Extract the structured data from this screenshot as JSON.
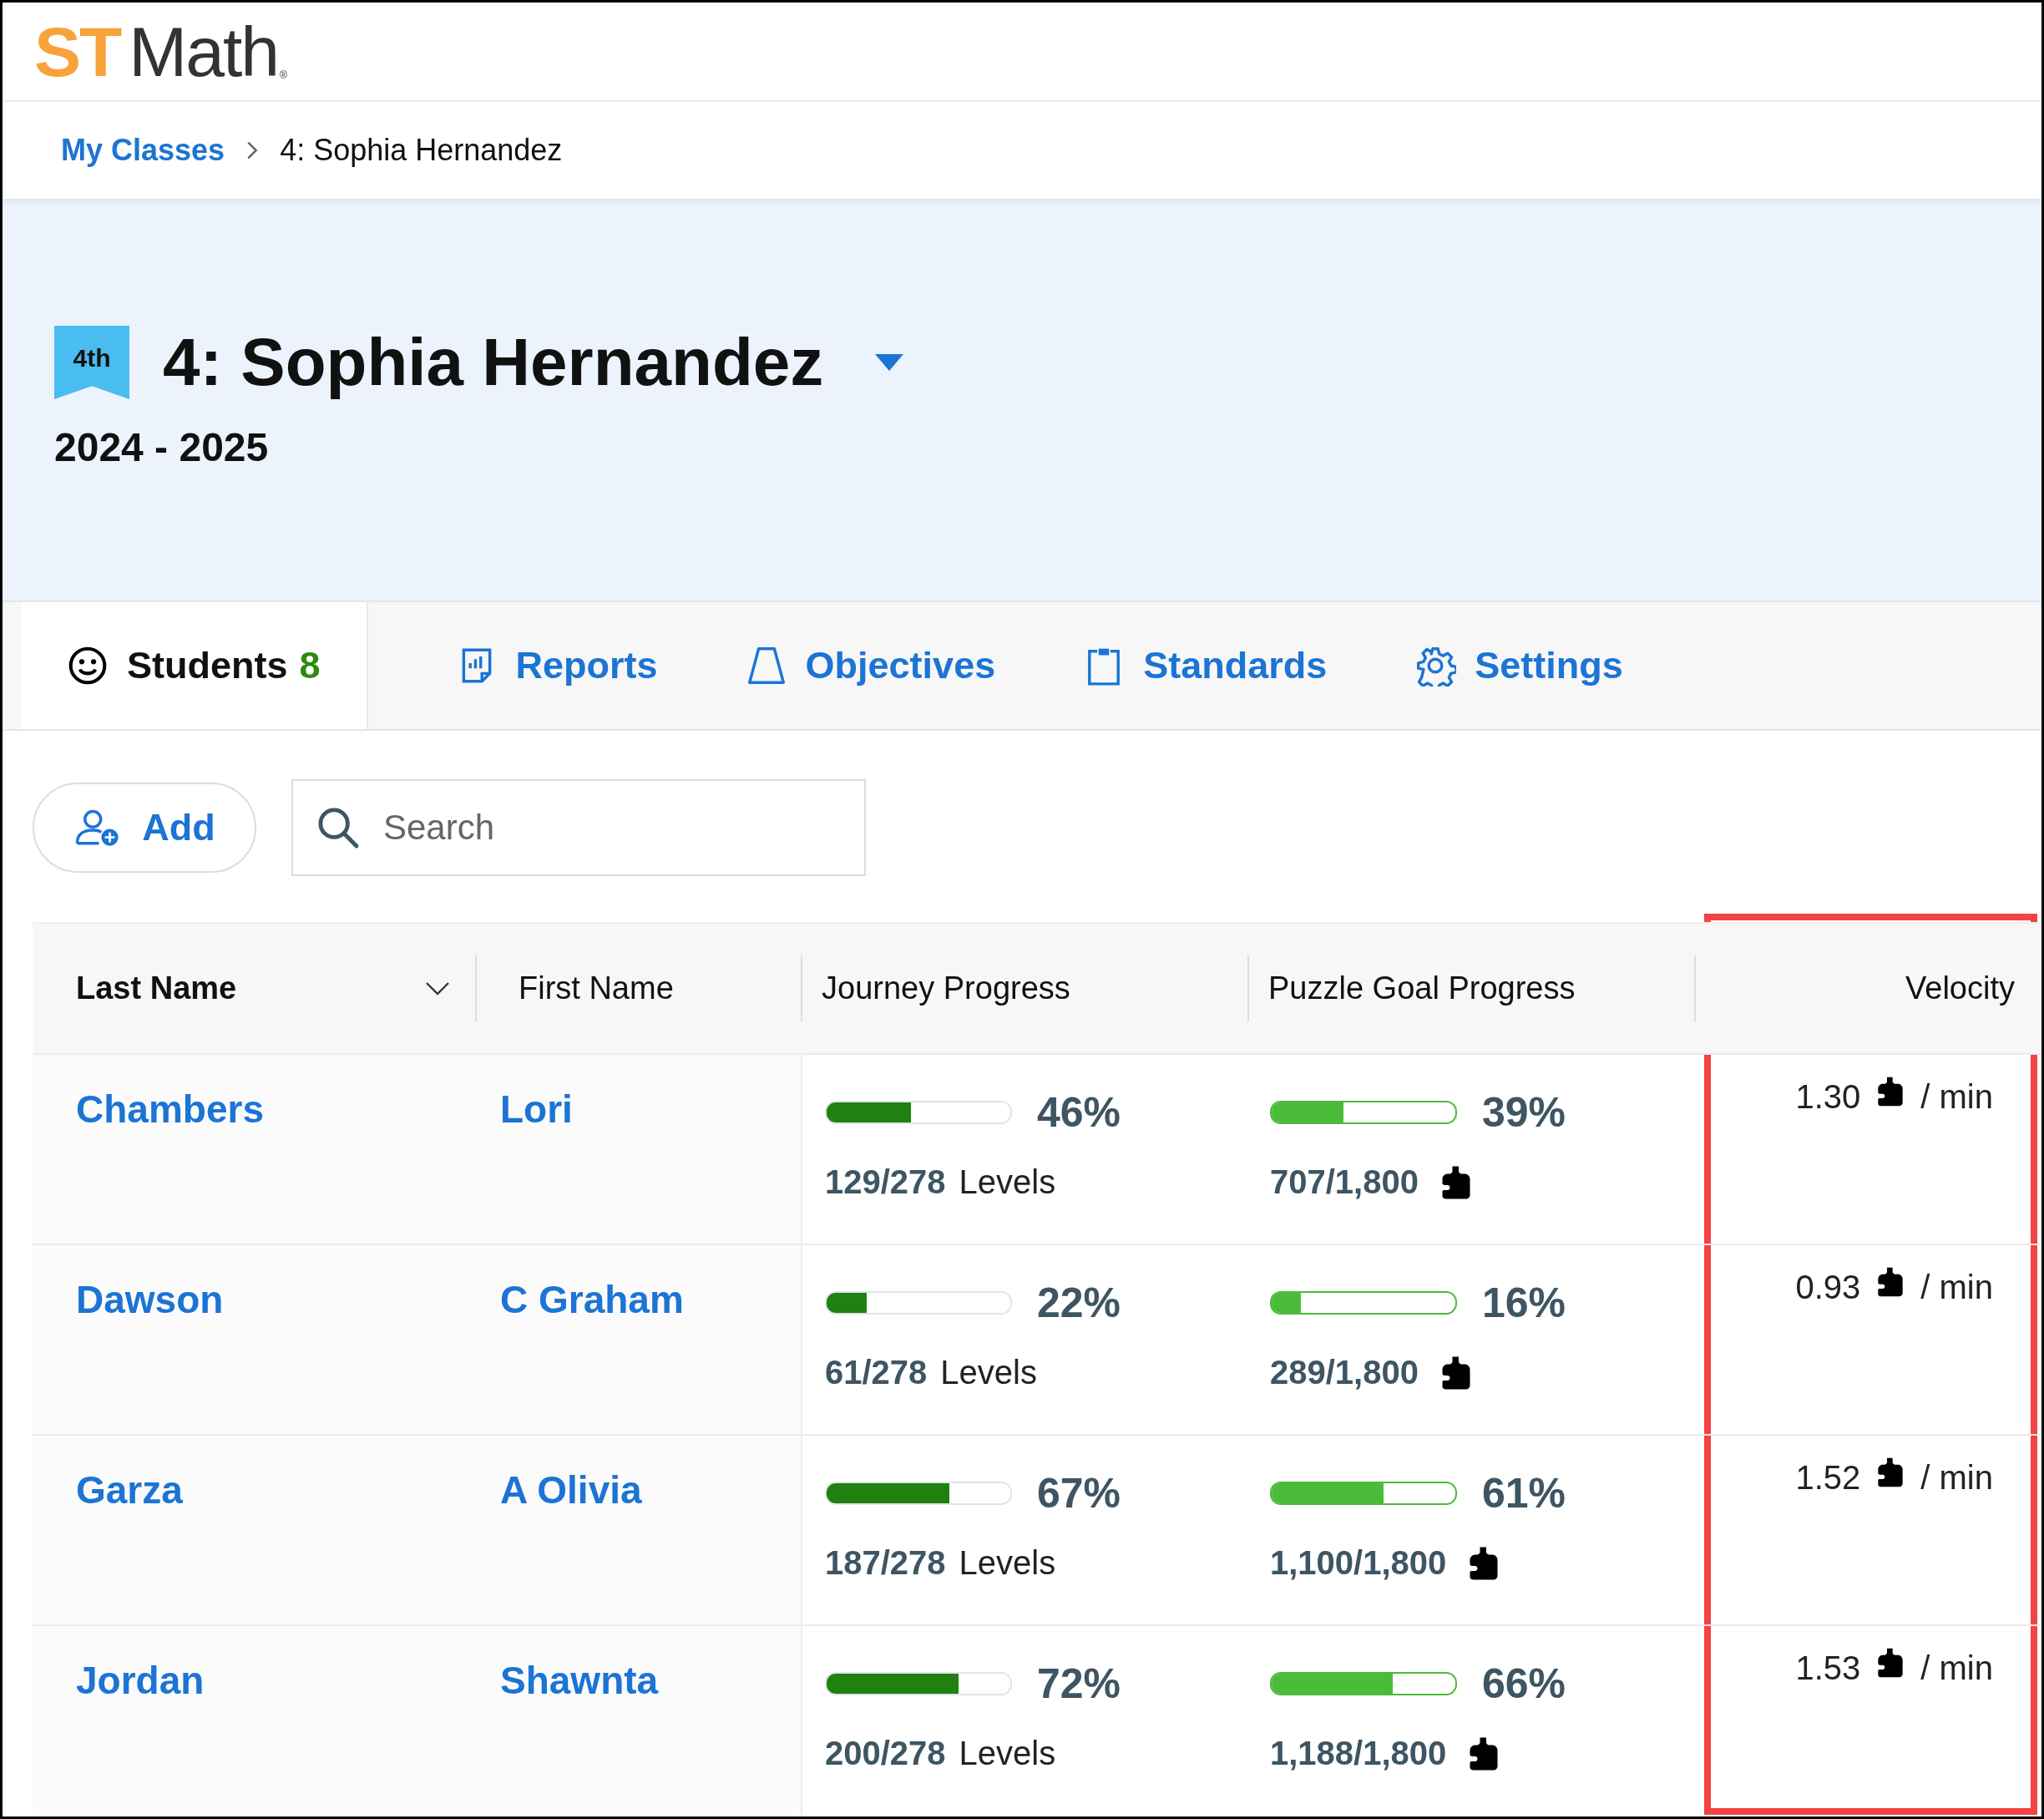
{
  "logo": {
    "brand": "ST",
    "product": "Math",
    "mark": "®"
  },
  "breadcrumb": [
    {
      "label": "My Classes",
      "kind": "link"
    },
    {
      "label": "4: Sophia Hernandez",
      "kind": "current"
    }
  ],
  "class_header": {
    "grade_badge": "4th",
    "title": "4: Sophia Hernandez",
    "school_year": "2024 - 2025"
  },
  "tabs": [
    {
      "label": "Students",
      "count": "8",
      "kind": "students",
      "selected": true
    },
    {
      "label": "Reports",
      "kind": "reports",
      "selected": false
    },
    {
      "label": "Objectives",
      "kind": "objectives",
      "selected": false
    },
    {
      "label": "Standards",
      "kind": "standards",
      "selected": false
    },
    {
      "label": "Settings",
      "kind": "settings",
      "selected": false
    }
  ],
  "actions": {
    "add_button": "Add",
    "search": {
      "placeholder": "Search"
    }
  },
  "table": {
    "columns": [
      {
        "label": "Last Name",
        "sortable": true,
        "highlighted": false
      },
      {
        "label": "First Name",
        "sortable": false,
        "highlighted": false
      },
      {
        "label": "Journey Progress",
        "sortable": false,
        "highlighted": false
      },
      {
        "label": "Puzzle Goal Progress",
        "sortable": false,
        "highlighted": false
      },
      {
        "label": "Velocity",
        "sortable": false,
        "highlighted": true
      }
    ],
    "rows": [
      {
        "last_name": "Chambers",
        "first_name": "Lori",
        "journey": {
          "level": 0.46,
          "percent": "46%",
          "count": "129/278",
          "unit": "Levels"
        },
        "puzzle_goal": {
          "level": 0.39,
          "percent": "39%",
          "count": "707/1,800"
        },
        "velocity": {
          "value": "1.30",
          "unit": "/ min"
        }
      },
      {
        "last_name": "Dawson",
        "first_name": "C Graham",
        "journey": {
          "level": 0.22,
          "percent": "22%",
          "count": "61/278",
          "unit": "Levels"
        },
        "puzzle_goal": {
          "level": 0.16,
          "percent": "16%",
          "count": "289/1,800"
        },
        "velocity": {
          "value": "0.93",
          "unit": "/ min"
        }
      },
      {
        "last_name": "Garza",
        "first_name": "A Olivia",
        "journey": {
          "level": 0.67,
          "percent": "67%",
          "count": "187/278",
          "unit": "Levels"
        },
        "puzzle_goal": {
          "level": 0.61,
          "percent": "61%",
          "count": "1,100/1,800"
        },
        "velocity": {
          "value": "1.52",
          "unit": "/ min"
        }
      },
      {
        "last_name": "Jordan",
        "first_name": "Shawnta",
        "journey": {
          "level": 0.72,
          "percent": "72%",
          "count": "200/278",
          "unit": "Levels"
        },
        "puzzle_goal": {
          "level": 0.66,
          "percent": "66%",
          "count": "1,188/1,800"
        },
        "velocity": {
          "value": "1.53",
          "unit": "/ min"
        }
      }
    ]
  }
}
